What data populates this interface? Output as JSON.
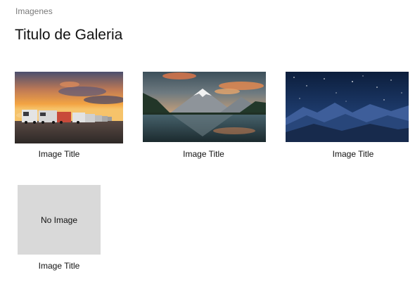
{
  "breadcrumb": "Imagenes",
  "title": "Titulo de Galeria",
  "gallery": {
    "items": [
      {
        "caption": "Image Title",
        "image": "sunset-trucks-photo"
      },
      {
        "caption": "Image Title",
        "image": "mountain-lake-photo"
      },
      {
        "caption": "Image Title",
        "image": "night-mountains-photo"
      },
      {
        "caption": "Image Title",
        "image": "none",
        "placeholder": "No Image"
      }
    ]
  }
}
